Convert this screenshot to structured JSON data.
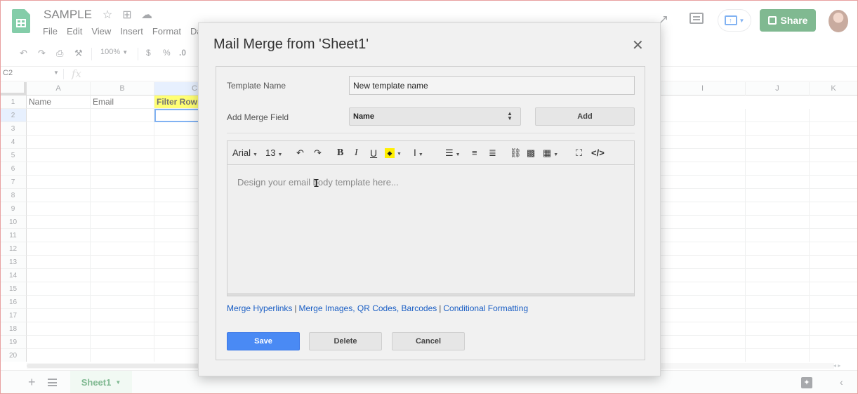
{
  "header": {
    "doc_title": "SAMPLE",
    "menu": [
      "File",
      "Edit",
      "View",
      "Insert",
      "Format",
      "Da"
    ],
    "share_label": "Share"
  },
  "toolbar": {
    "zoom": "100%",
    "currency": "$",
    "percent": "%",
    "decimal": ".0"
  },
  "formula_bar": {
    "name_box": "C2",
    "fx": "fx"
  },
  "grid": {
    "columns": [
      "A",
      "B",
      "C",
      "I",
      "J",
      "K"
    ],
    "rows": [
      "1",
      "2",
      "3",
      "4",
      "5",
      "6",
      "7",
      "8",
      "9",
      "10",
      "11",
      "12",
      "13",
      "14",
      "15",
      "16",
      "17",
      "18",
      "19",
      "20"
    ],
    "row1": {
      "a": "Name",
      "b": "Email",
      "c": "Filter Row"
    }
  },
  "sheets": {
    "active_tab": "Sheet1"
  },
  "dialog": {
    "title": "Mail Merge from 'Sheet1'",
    "template_name_label": "Template Name",
    "template_name_value": "New template name",
    "merge_field_label": "Add Merge Field",
    "merge_field_value": "Name",
    "add_button": "Add",
    "editor": {
      "font": "Arial",
      "size": "13",
      "placeholder": "Design your email body template here..."
    },
    "links": {
      "hyperlinks": "Merge Hyperlinks",
      "images": "Merge Images, QR Codes, Barcodes",
      "conditional": "Conditional Formatting"
    },
    "save_button": "Save",
    "delete_button": "Delete",
    "cancel_button": "Cancel"
  },
  "colors": {
    "sheets_green": "#188038",
    "filter_yellow": "#ffff00",
    "save_blue": "#4a8af4",
    "link_blue": "#1a5ec4",
    "selection_blue": "#1a73e8"
  }
}
